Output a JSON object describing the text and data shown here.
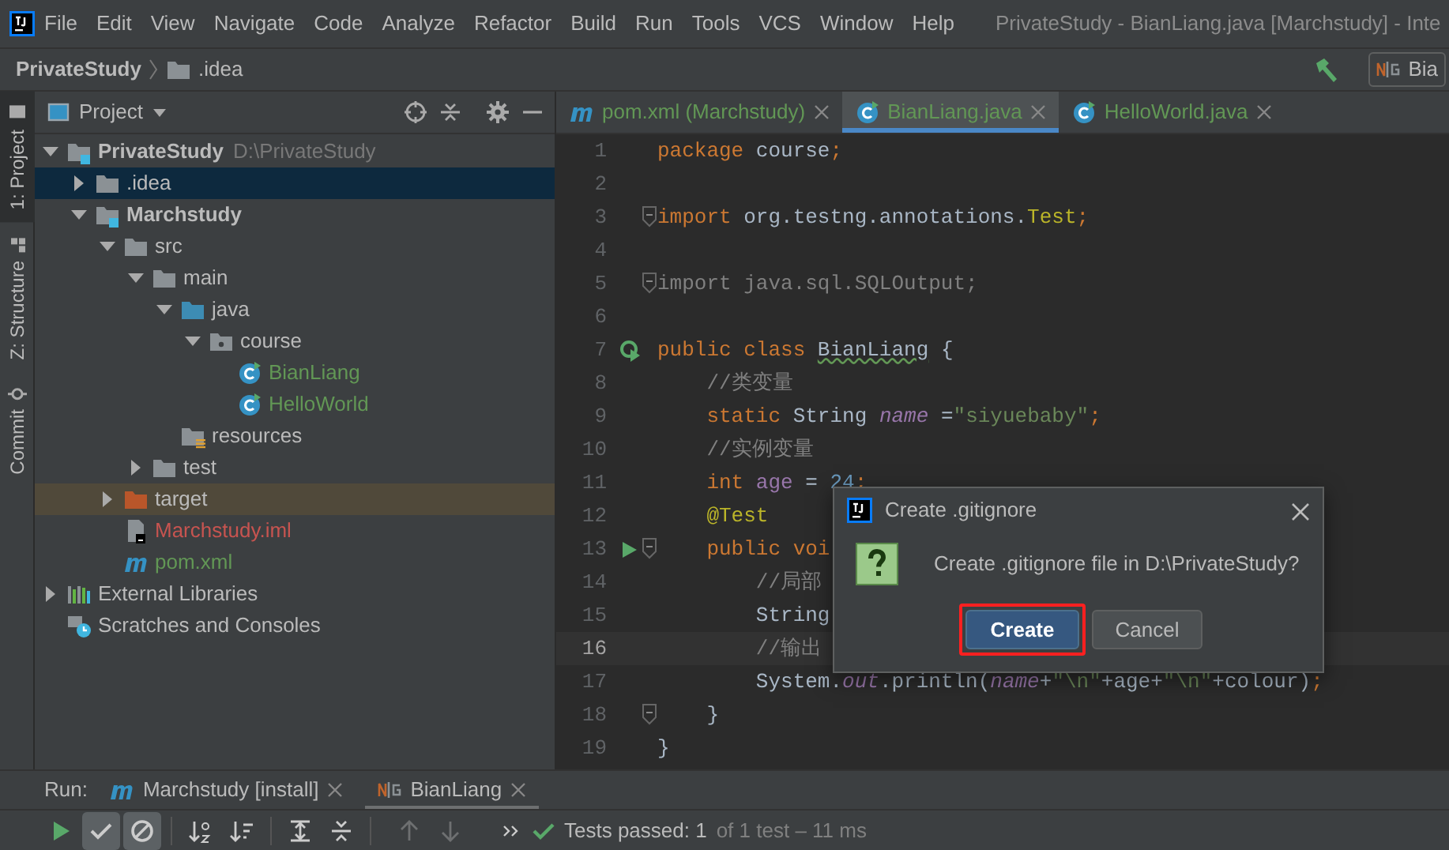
{
  "menu": [
    "File",
    "Edit",
    "View",
    "Navigate",
    "Code",
    "Analyze",
    "Refactor",
    "Build",
    "Run",
    "Tools",
    "VCS",
    "Window",
    "Help"
  ],
  "window": {
    "title": "PrivateStudy - BianLiang.java [Marchstudy] - Inte"
  },
  "breadcrumb": [
    {
      "label": "PrivateStudy",
      "kind": "project"
    },
    {
      "label": ".idea",
      "kind": "folder"
    }
  ],
  "run_config": {
    "label": "Bia"
  },
  "tool_strip": [
    {
      "label": "1: Project",
      "kind": "project",
      "selected": true
    },
    {
      "label": "Z: Structure",
      "kind": "structure",
      "selected": false
    },
    {
      "label": "Commit",
      "kind": "commit",
      "selected": false
    }
  ],
  "project_panel": {
    "title": "Project",
    "tree": [
      {
        "label": "PrivateStudy",
        "detail": "D:\\PrivateStudy",
        "kind": "module",
        "bold": true,
        "color": "#bbbbbb",
        "expanded": true,
        "selected": false,
        "hovered": false,
        "children": [
          {
            "label": ".idea",
            "kind": "folder",
            "bold": false,
            "expanded": false,
            "selected": true,
            "hovered": false
          },
          {
            "label": "Marchstudy",
            "kind": "module",
            "bold": true,
            "color": "#bbbbbb",
            "expanded": true,
            "selected": false,
            "hovered": false,
            "children": [
              {
                "label": "src",
                "kind": "folder",
                "bold": false,
                "color": "#bbbbbb",
                "expanded": true,
                "selected": false,
                "hovered": false,
                "children": [
                  {
                    "label": "main",
                    "kind": "folder",
                    "bold": false,
                    "color": "#bbbbbb",
                    "expanded": true,
                    "selected": false,
                    "hovered": false,
                    "children": [
                      {
                        "label": "java",
                        "kind": "source",
                        "bold": false,
                        "color": "#bbbbbb",
                        "expanded": true,
                        "selected": false,
                        "hovered": false,
                        "children": [
                          {
                            "label": "course",
                            "kind": "package",
                            "bold": false,
                            "color": "#bbbbbb",
                            "expanded": true,
                            "selected": false,
                            "hovered": false,
                            "children": [
                              {
                                "label": "BianLiang",
                                "kind": "class",
                                "bold": false,
                                "color": "#629755",
                                "selected": false,
                                "hovered": false
                              },
                              {
                                "label": "HelloWorld",
                                "kind": "class",
                                "bold": false,
                                "color": "#629755",
                                "selected": false,
                                "hovered": false
                              }
                            ]
                          }
                        ]
                      },
                      {
                        "label": "resources",
                        "kind": "resources",
                        "bold": false,
                        "color": "#bbbbbb",
                        "selected": false,
                        "hovered": false
                      }
                    ]
                  },
                  {
                    "label": "test",
                    "kind": "folder",
                    "bold": false,
                    "color": "#bbbbbb",
                    "expanded": false,
                    "selected": false,
                    "hovered": false
                  }
                ]
              },
              {
                "label": "target",
                "kind": "excluded",
                "bold": false,
                "color": "#bbbbbb",
                "expanded": false,
                "selected": false,
                "hovered": true
              },
              {
                "label": "Marchstudy.iml",
                "kind": "iml",
                "bold": false,
                "color": "#c75450",
                "selected": false,
                "hovered": false
              },
              {
                "label": "pom.xml",
                "kind": "maven",
                "bold": false,
                "color": "#629755",
                "selected": false,
                "hovered": false
              }
            ]
          }
        ]
      },
      {
        "label": "External Libraries",
        "kind": "libraries",
        "bold": false,
        "color": "#bbbbbb",
        "expanded": false,
        "selected": false,
        "hovered": false
      },
      {
        "label": "Scratches and Consoles",
        "kind": "scratches",
        "bold": false,
        "color": "#bbbbbb",
        "selected": false,
        "hovered": false
      }
    ]
  },
  "editor_tabs": [
    {
      "label": "pom.xml (Marchstudy)",
      "kind": "maven",
      "selected": false
    },
    {
      "label": "BianLiang.java",
      "kind": "class",
      "selected": true
    },
    {
      "label": "HelloWorld.java",
      "kind": "class",
      "selected": false
    }
  ],
  "code": [
    {
      "number": "1",
      "current": false,
      "fold": false,
      "kind": "plain",
      "tokens": [
        {
          "text": "package ",
          "kind": "keyword"
        },
        {
          "text": "course",
          "kind": "plain"
        },
        {
          "text": ";",
          "kind": "keyword"
        }
      ]
    },
    {
      "number": "2",
      "current": false,
      "fold": false,
      "kind": "plain"
    },
    {
      "number": "3",
      "current": false,
      "fold": true,
      "kind": "plain",
      "tokens": [
        {
          "text": "import ",
          "kind": "keyword"
        },
        {
          "text": "org.testng.annotations.",
          "kind": "plain"
        },
        {
          "text": "Test",
          "kind": "annotation"
        },
        {
          "text": ";",
          "kind": "keyword"
        }
      ]
    },
    {
      "number": "4",
      "current": false,
      "fold": false,
      "kind": "plain"
    },
    {
      "number": "5",
      "current": false,
      "fold": true,
      "kind": "plain",
      "tokens": [
        {
          "text": "import java.sql.SQLOutput;",
          "kind": "unused"
        }
      ]
    },
    {
      "number": "6",
      "current": false,
      "fold": false,
      "kind": "plain"
    },
    {
      "number": "7",
      "current": false,
      "fold": false,
      "kind": "run-class",
      "tokens": [
        {
          "text": "public class ",
          "kind": "keyword"
        },
        {
          "text": "BianLiang",
          "kind": "typo"
        },
        {
          "text": " {",
          "kind": "plain"
        }
      ]
    },
    {
      "number": "8",
      "current": false,
      "fold": false,
      "kind": "plain",
      "tokens": [
        {
          "text": "    //类变量",
          "kind": "comment"
        }
      ]
    },
    {
      "number": "9",
      "current": false,
      "fold": false,
      "kind": "plain",
      "tokens": [
        {
          "text": "    static ",
          "kind": "keyword"
        },
        {
          "text": "String ",
          "kind": "plain"
        },
        {
          "text": "name",
          "kind": "field"
        },
        {
          "text": " =",
          "kind": "plain"
        },
        {
          "text": "\"siyuebaby\"",
          "kind": "string"
        },
        {
          "text": ";",
          "kind": "keyword"
        }
      ]
    },
    {
      "number": "10",
      "current": false,
      "fold": false,
      "kind": "plain",
      "tokens": [
        {
          "text": "    //实例变量",
          "kind": "comment"
        }
      ]
    },
    {
      "number": "11",
      "current": false,
      "fold": false,
      "kind": "plain",
      "tokens": [
        {
          "text": "    int ",
          "kind": "keyword"
        },
        {
          "text": "age",
          "kind": "member"
        },
        {
          "text": " = ",
          "kind": "plain"
        },
        {
          "text": "24",
          "kind": "number"
        },
        {
          "text": ";",
          "kind": "keyword"
        }
      ]
    },
    {
      "number": "12",
      "current": false,
      "fold": false,
      "kind": "plain",
      "tokens": [
        {
          "text": "    @Test",
          "kind": "annotation"
        }
      ]
    },
    {
      "number": "13",
      "current": false,
      "fold": true,
      "kind": "run",
      "tokens": [
        {
          "text": "    public voi",
          "kind": "keyword"
        }
      ]
    },
    {
      "number": "14",
      "current": false,
      "fold": false,
      "kind": "plain",
      "tokens": [
        {
          "text": "        //局部",
          "kind": "comment"
        }
      ]
    },
    {
      "number": "15",
      "current": false,
      "fold": false,
      "kind": "plain",
      "tokens": [
        {
          "text": "        String",
          "kind": "plain"
        }
      ]
    },
    {
      "number": "16",
      "current": true,
      "fold": false,
      "kind": "plain",
      "tokens": [
        {
          "text": "        //输出",
          "kind": "comment"
        }
      ]
    },
    {
      "number": "17",
      "current": false,
      "fold": false,
      "kind": "plain",
      "tokens": [
        {
          "text": "        System.",
          "kind": "plain"
        },
        {
          "text": "out",
          "kind": "field"
        },
        {
          "text": ".println(",
          "kind": "plain"
        },
        {
          "text": "name",
          "kind": "field"
        },
        {
          "text": "+",
          "kind": "plain"
        },
        {
          "text": "\"\\n\"",
          "kind": "string"
        },
        {
          "text": "+age+",
          "kind": "plain"
        },
        {
          "text": "\"\\n\"",
          "kind": "string"
        },
        {
          "text": "+colour)",
          "kind": "plain"
        },
        {
          "text": ";",
          "kind": "keyword"
        }
      ]
    },
    {
      "number": "18",
      "current": false,
      "fold": true,
      "kind": "plain",
      "tokens": [
        {
          "text": "    }",
          "kind": "plain"
        }
      ]
    },
    {
      "number": "19",
      "current": false,
      "fold": false,
      "kind": "plain",
      "tokens": [
        {
          "text": "}",
          "kind": "plain"
        }
      ]
    }
  ],
  "dialog": {
    "title": "Create .gitignore",
    "message": "Create .gitignore file in D:\\PrivateStudy?",
    "buttons": [
      {
        "label": "Create",
        "default": true,
        "highlighted": true
      },
      {
        "label": "Cancel",
        "default": false,
        "highlighted": false
      }
    ]
  },
  "run_panel": {
    "label": "Run:",
    "tabs": [
      {
        "label": "Marchstudy [install]",
        "kind": "maven",
        "selected": false
      },
      {
        "label": "BianLiang",
        "kind": "testng",
        "selected": true
      }
    ],
    "toolbar": [
      {
        "kind": "run",
        "on": false,
        "disabled": false
      },
      {
        "kind": "check",
        "on": true,
        "disabled": false
      },
      {
        "kind": "ignored",
        "on": true,
        "disabled": false
      },
      {
        "kind": "sep"
      },
      {
        "kind": "sort-alpha",
        "on": false,
        "disabled": false
      },
      {
        "kind": "sort-duration",
        "on": false,
        "disabled": false
      },
      {
        "kind": "sep"
      },
      {
        "kind": "expand",
        "on": false,
        "disabled": false
      },
      {
        "kind": "collapse",
        "on": false,
        "disabled": false
      },
      {
        "kind": "sep"
      },
      {
        "kind": "up",
        "on": false,
        "disabled": true
      },
      {
        "kind": "down",
        "on": false,
        "disabled": true
      },
      {
        "kind": "more",
        "on": false,
        "disabled": false
      }
    ],
    "status": {
      "main": "Tests passed: 1",
      "detail": "of 1 test – 11 ms"
    }
  }
}
